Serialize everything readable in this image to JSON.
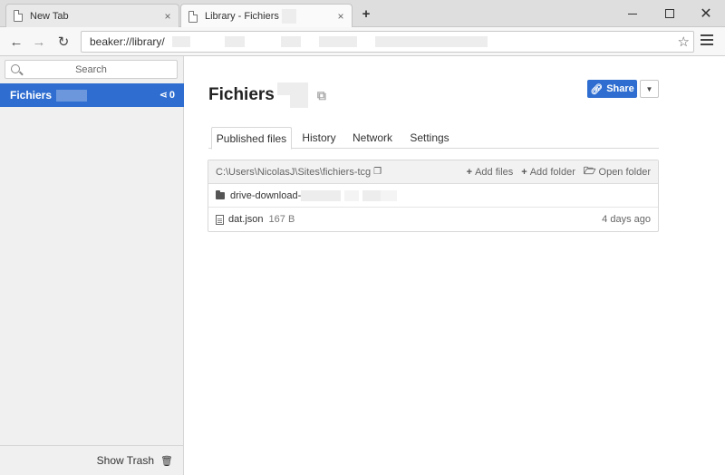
{
  "browser": {
    "tabs": [
      {
        "title": "New Tab",
        "close": "×"
      },
      {
        "title": "Library - Fichiers",
        "close": "×"
      }
    ],
    "new_tab": "+",
    "url": "beaker://library/"
  },
  "sidebar": {
    "search_placeholder": "Search",
    "archives": [
      {
        "name": "Fichiers",
        "peers": "0"
      }
    ],
    "show_trash": "Show Trash"
  },
  "main": {
    "title": "Fichiers",
    "share_label": "Share",
    "tabs": [
      "Published files",
      "History",
      "Network",
      "Settings"
    ],
    "files_header": {
      "path": "C:\\Users\\NicolasJ\\Sites\\fichiers-tcg",
      "add_files": "Add files",
      "add_folder": "Add folder",
      "open_folder": "Open folder"
    },
    "files": [
      {
        "name": "drive-download-",
        "type": "folder",
        "size": "",
        "date": ""
      },
      {
        "name": "dat.json",
        "type": "file",
        "size": "167 B",
        "date": "4 days ago"
      }
    ]
  },
  "colors": {
    "accent": "#2f6ed0"
  }
}
